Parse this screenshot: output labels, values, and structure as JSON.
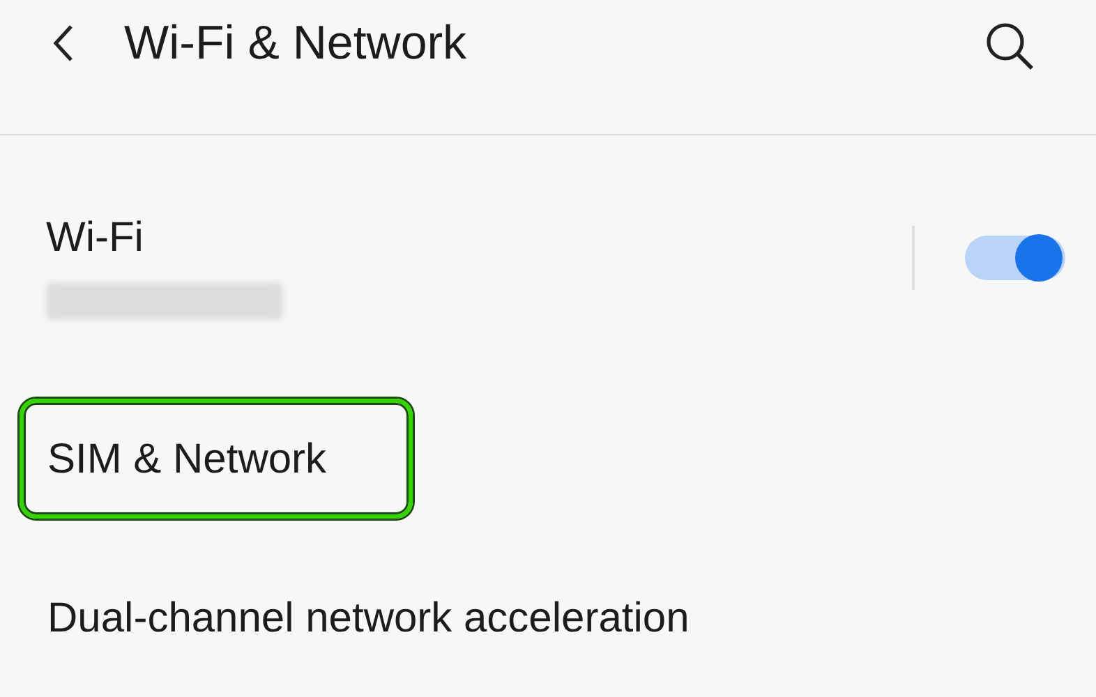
{
  "header": {
    "title": "Wi-Fi & Network"
  },
  "items": [
    {
      "kind": "toggle",
      "label": "Wi-Fi",
      "subtitle_blurred": true,
      "on": true
    },
    {
      "kind": "link",
      "label": "SIM & Network",
      "highlighted": true
    },
    {
      "kind": "link",
      "label": "Dual-channel network acceleration",
      "highlighted": false
    }
  ]
}
